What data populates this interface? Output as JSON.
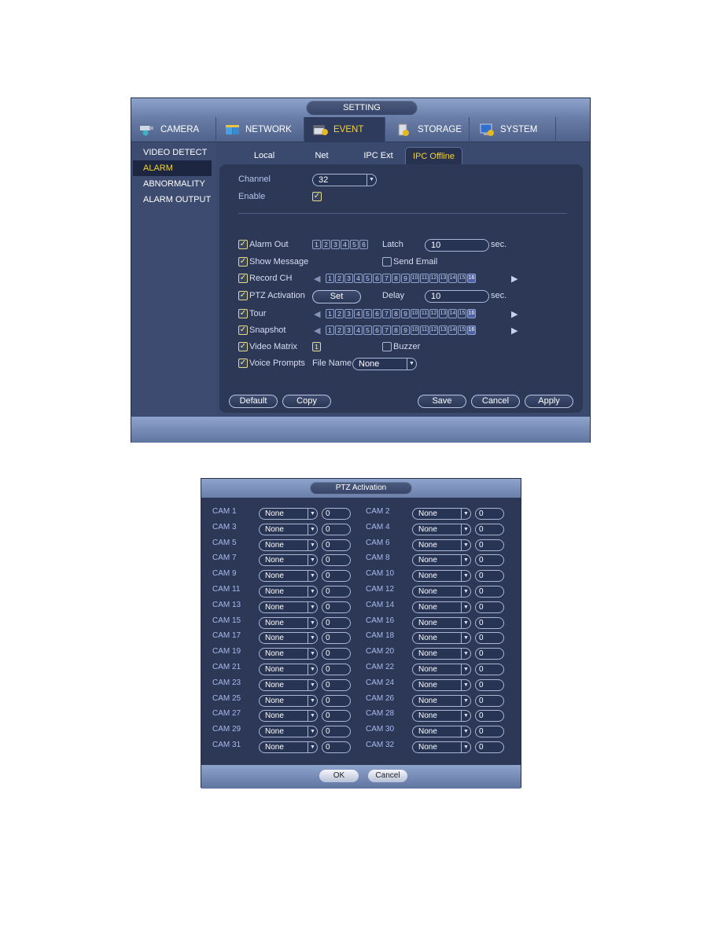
{
  "window": {
    "title": "SETTING"
  },
  "main_tabs": [
    {
      "label": "CAMERA",
      "icon": "camera-icon",
      "active": false
    },
    {
      "label": "NETWORK",
      "icon": "network-icon",
      "active": false
    },
    {
      "label": "EVENT",
      "icon": "event-icon",
      "active": true
    },
    {
      "label": "STORAGE",
      "icon": "storage-icon",
      "active": false
    },
    {
      "label": "SYSTEM",
      "icon": "system-icon",
      "active": false
    }
  ],
  "sidebar": {
    "items": [
      {
        "label": "VIDEO DETECT",
        "active": false
      },
      {
        "label": "ALARM",
        "active": true
      },
      {
        "label": "ABNORMALITY",
        "active": false
      },
      {
        "label": "ALARM OUTPUT",
        "active": false
      }
    ]
  },
  "sub_tabs": [
    {
      "label": "Local",
      "active": false
    },
    {
      "label": "Net",
      "active": false
    },
    {
      "label": "IPC Ext",
      "active": false
    },
    {
      "label": "IPC Offline",
      "active": true
    }
  ],
  "form": {
    "channel_label": "Channel",
    "channel_value": "32",
    "enable_label": "Enable",
    "enable_checked": true,
    "alarm_out": {
      "label": "Alarm Out",
      "checked": true,
      "channels": [
        "1",
        "2",
        "3",
        "4",
        "5",
        "6"
      ]
    },
    "latch": {
      "label": "Latch",
      "value": "10",
      "unit": "sec."
    },
    "show_message": {
      "label": "Show Message",
      "checked": true
    },
    "send_email": {
      "label": "Send Email",
      "checked": false
    },
    "record_ch": {
      "label": "Record CH",
      "checked": true,
      "channels": [
        "1",
        "2",
        "3",
        "4",
        "5",
        "6",
        "7",
        "8",
        "9",
        "10",
        "11",
        "12",
        "13",
        "14",
        "15",
        "16"
      ],
      "selected": [
        "16"
      ]
    },
    "ptz_activation": {
      "label": "PTZ Activation",
      "checked": true,
      "button": "Set"
    },
    "delay": {
      "label": "Delay",
      "value": "10",
      "unit": "sec."
    },
    "tour": {
      "label": "Tour",
      "checked": true,
      "channels": [
        "1",
        "2",
        "3",
        "4",
        "5",
        "6",
        "7",
        "8",
        "9",
        "10",
        "11",
        "12",
        "13",
        "14",
        "15",
        "16"
      ],
      "selected": [
        "16"
      ]
    },
    "snapshot": {
      "label": "Snapshot",
      "checked": true,
      "channels": [
        "1",
        "2",
        "3",
        "4",
        "5",
        "6",
        "7",
        "8",
        "9",
        "10",
        "11",
        "12",
        "13",
        "14",
        "15",
        "16"
      ],
      "selected": [
        "16"
      ]
    },
    "video_matrix": {
      "label": "Video Matrix",
      "checked": true,
      "channel": "1"
    },
    "buzzer": {
      "label": "Buzzer",
      "checked": false
    },
    "voice_prompts": {
      "label": "Voice Prompts",
      "checked": true
    },
    "file_name": {
      "label": "File Name",
      "value": "None"
    }
  },
  "buttons": {
    "default": "Default",
    "copy": "Copy",
    "save": "Save",
    "cancel": "Cancel",
    "apply": "Apply"
  },
  "ptz_dialog": {
    "title": "PTZ Activation",
    "cams": [
      {
        "label": "CAM 1",
        "type": "None",
        "value": "0"
      },
      {
        "label": "CAM 2",
        "type": "None",
        "value": "0"
      },
      {
        "label": "CAM 3",
        "type": "None",
        "value": "0"
      },
      {
        "label": "CAM 4",
        "type": "None",
        "value": "0"
      },
      {
        "label": "CAM 5",
        "type": "None",
        "value": "0"
      },
      {
        "label": "CAM 6",
        "type": "None",
        "value": "0"
      },
      {
        "label": "CAM 7",
        "type": "None",
        "value": "0"
      },
      {
        "label": "CAM 8",
        "type": "None",
        "value": "0"
      },
      {
        "label": "CAM 9",
        "type": "None",
        "value": "0"
      },
      {
        "label": "CAM 10",
        "type": "None",
        "value": "0"
      },
      {
        "label": "CAM 11",
        "type": "None",
        "value": "0"
      },
      {
        "label": "CAM 12",
        "type": "None",
        "value": "0"
      },
      {
        "label": "CAM 13",
        "type": "None",
        "value": "0"
      },
      {
        "label": "CAM 14",
        "type": "None",
        "value": "0"
      },
      {
        "label": "CAM 15",
        "type": "None",
        "value": "0"
      },
      {
        "label": "CAM 16",
        "type": "None",
        "value": "0"
      },
      {
        "label": "CAM 17",
        "type": "None",
        "value": "0"
      },
      {
        "label": "CAM 18",
        "type": "None",
        "value": "0"
      },
      {
        "label": "CAM 19",
        "type": "None",
        "value": "0"
      },
      {
        "label": "CAM 20",
        "type": "None",
        "value": "0"
      },
      {
        "label": "CAM 21",
        "type": "None",
        "value": "0"
      },
      {
        "label": "CAM 22",
        "type": "None",
        "value": "0"
      },
      {
        "label": "CAM 23",
        "type": "None",
        "value": "0"
      },
      {
        "label": "CAM 24",
        "type": "None",
        "value": "0"
      },
      {
        "label": "CAM 25",
        "type": "None",
        "value": "0"
      },
      {
        "label": "CAM 26",
        "type": "None",
        "value": "0"
      },
      {
        "label": "CAM 27",
        "type": "None",
        "value": "0"
      },
      {
        "label": "CAM 28",
        "type": "None",
        "value": "0"
      },
      {
        "label": "CAM 29",
        "type": "None",
        "value": "0"
      },
      {
        "label": "CAM 30",
        "type": "None",
        "value": "0"
      },
      {
        "label": "CAM 31",
        "type": "None",
        "value": "0"
      },
      {
        "label": "CAM 32",
        "type": "None",
        "value": "0"
      }
    ],
    "ok": "OK",
    "cancel": "Cancel"
  },
  "colors": {
    "accent": "#f2d23a",
    "panel": "#2c3856",
    "label": "#b7c4ec"
  }
}
